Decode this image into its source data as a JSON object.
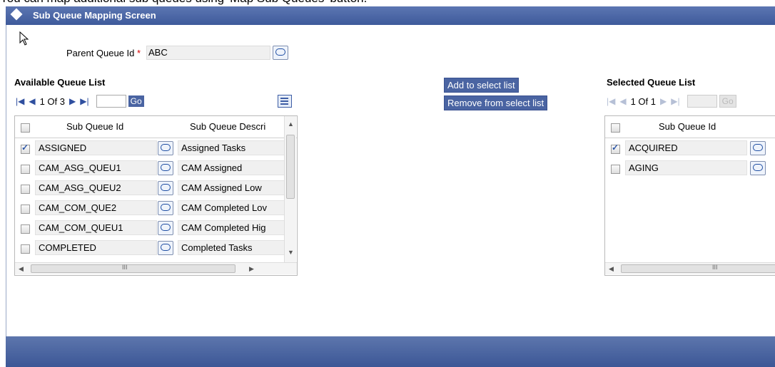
{
  "instruction_text": "You can map additional sub queues using 'Map Sub Queues' button.",
  "window": {
    "title": "Sub Queue Mapping Screen"
  },
  "parent": {
    "label": "Parent Queue Id",
    "required_mark": "*",
    "value": "ABC"
  },
  "available": {
    "title": "Available Queue List",
    "page_text": "1 Of 3",
    "go_label": "Go",
    "columns": [
      "Sub Queue Id",
      "Sub Queue Descri"
    ],
    "rows": [
      {
        "checked": true,
        "id": "ASSIGNED",
        "desc": "Assigned Tasks"
      },
      {
        "checked": false,
        "id": "CAM_ASG_QUEU1",
        "desc": "CAM Assigned"
      },
      {
        "checked": false,
        "id": "CAM_ASG_QUEU2",
        "desc": "CAM Assigned Low"
      },
      {
        "checked": false,
        "id": "CAM_COM_QUE2",
        "desc": "CAM Completed Lov"
      },
      {
        "checked": false,
        "id": "CAM_COM_QUEU1",
        "desc": "CAM Completed Hig"
      },
      {
        "checked": false,
        "id": "COMPLETED",
        "desc": "Completed Tasks"
      }
    ],
    "scroll_mark": "III"
  },
  "actions": {
    "add_label": "Add to select list",
    "remove_label": "Remove from select list"
  },
  "selected": {
    "title": "Selected Queue List",
    "page_text": "1 Of 1",
    "go_label": "Go",
    "columns": [
      "Sub Queue Id"
    ],
    "rows": [
      {
        "checked": true,
        "id": "ACQUIRED"
      },
      {
        "checked": false,
        "id": "AGING"
      }
    ],
    "scroll_mark": "III"
  },
  "icons": [
    "diamond-icon",
    "cursor-icon",
    "lov-icon",
    "first-page-icon",
    "prev-page-icon",
    "next-page-icon",
    "last-page-icon",
    "column-list-icon"
  ],
  "colors": {
    "header_bar": "#4a64a2",
    "footer_bar": "#4a64a2",
    "required": "#d60000"
  }
}
